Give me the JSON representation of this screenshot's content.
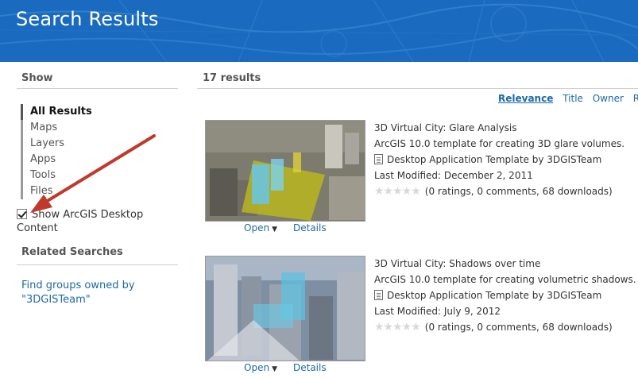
{
  "header": {
    "title": "Search Results"
  },
  "sidebar": {
    "show_heading": "Show",
    "filters": [
      {
        "label": "All Results",
        "active": true
      },
      {
        "label": "Maps",
        "active": false
      },
      {
        "label": "Layers",
        "active": false
      },
      {
        "label": "Apps",
        "active": false
      },
      {
        "label": "Tools",
        "active": false
      },
      {
        "label": "Files",
        "active": false
      }
    ],
    "desktop_content": {
      "label_line1": "Show ArcGIS Desktop",
      "label_line2": "Content",
      "checked": true
    },
    "related_heading": "Related Searches",
    "related_link": {
      "line1": "Find groups owned by",
      "line2": "\"3DGISTeam\""
    }
  },
  "main": {
    "results_count": "17 results",
    "sort": {
      "relevance": "Relevance",
      "title": "Title",
      "owner": "Owner",
      "rating": "Ra"
    },
    "open_label": "Open",
    "details_label": "Details",
    "results": [
      {
        "title": "3D Virtual City: Glare Analysis",
        "description": "ArcGIS 10.0 template for creating 3D glare volumes.",
        "owner_line": "Desktop Application Template by 3DGISTeam",
        "modified": "Last Modified: December 2, 2011",
        "stats": "(0 ratings, 0 comments, 68 downloads)"
      },
      {
        "title": "3D Virtual City: Shadows over time",
        "description": "ArcGIS 10.0 template for creating volumetric shadows.",
        "owner_line": "Desktop Application Template by 3DGISTeam",
        "modified": "Last Modified: July 9, 2012",
        "stats": "(0 ratings, 0 comments, 68 downloads)"
      }
    ]
  },
  "colors": {
    "banner": "#1a6bbf",
    "link": "#1c6aa5",
    "annotation_arrow": "#c0392b"
  },
  "icons": [
    "checkbox-icon",
    "document-icon",
    "star-rating-icon",
    "dropdown-caret-icon",
    "annotation-arrow"
  ]
}
